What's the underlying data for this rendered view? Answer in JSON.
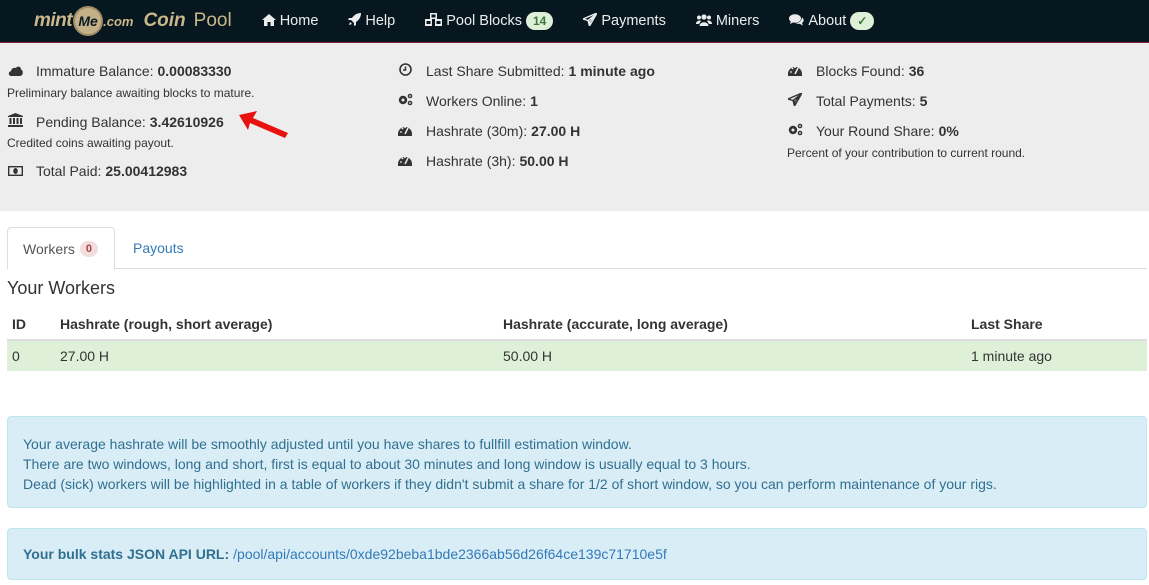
{
  "navbar": {
    "brand": {
      "mint": "mint",
      "me": "Me",
      "dotcom": ".com",
      "coin": "Coin",
      "pool": "Pool"
    },
    "items": [
      {
        "label": "Home",
        "icon": "home-icon",
        "glyph": "⌂"
      },
      {
        "label": "Help",
        "icon": "rocket-icon",
        "glyph": "🚀"
      },
      {
        "label": "Pool Blocks",
        "icon": "cubes-icon",
        "glyph": "❖",
        "badge": "14"
      },
      {
        "label": "Payments",
        "icon": "paper-plane-icon",
        "glyph": "➢"
      },
      {
        "label": "Miners",
        "icon": "users-icon",
        "glyph": "👥"
      },
      {
        "label": "About",
        "icon": "comments-icon",
        "glyph": "💬",
        "badge": "✓"
      }
    ],
    "colors": {
      "background": "#061720",
      "accent_border": "#8a1d3a",
      "brand": "#cbb78b"
    }
  },
  "stats": {
    "immature_balance": {
      "label": "Immature Balance:",
      "value": "0.00083330",
      "note": "Preliminary balance awaiting blocks to mature.",
      "icon": "cloud-icon"
    },
    "pending_balance": {
      "label": "Pending Balance:",
      "value": "3.42610926",
      "note": "Credited coins awaiting payout.",
      "icon": "bank-icon"
    },
    "total_paid": {
      "label": "Total Paid:",
      "value": "25.00412983",
      "icon": "money-icon"
    },
    "last_share": {
      "label": "Last Share Submitted:",
      "value": "1 minute ago",
      "icon": "clock-icon"
    },
    "workers_online": {
      "label": "Workers Online:",
      "value": "1",
      "icon": "gears-icon"
    },
    "hashrate_30m": {
      "label": "Hashrate (30m):",
      "value": "27.00 H",
      "icon": "dashboard-icon"
    },
    "hashrate_3h": {
      "label": "Hashrate (3h):",
      "value": "50.00 H",
      "icon": "dashboard-icon"
    },
    "blocks_found": {
      "label": "Blocks Found:",
      "value": "36",
      "icon": "dashboard-icon"
    },
    "total_payments": {
      "label": "Total Payments:",
      "value": "5",
      "icon": "paper-plane-icon"
    },
    "round_share": {
      "label": "Your Round Share:",
      "value": "0%",
      "note": "Percent of your contribution to current round.",
      "icon": "gears-icon"
    }
  },
  "tabs": [
    {
      "label": "Workers",
      "badge": "0",
      "active": true
    },
    {
      "label": "Payouts",
      "active": false
    }
  ],
  "workers": {
    "title": "Your Workers",
    "columns": [
      "ID",
      "Hashrate (rough, short average)",
      "Hashrate (accurate, long average)",
      "Last Share"
    ],
    "rows": [
      [
        "0",
        "27.00 H",
        "50.00 H",
        "1 minute ago"
      ]
    ]
  },
  "info": {
    "lines": [
      "Your average hashrate will be smoothly adjusted until you have shares to fullfill estimation window.",
      "There are two windows, long and short, first is equal to about 30 minutes and long window is usually equal to 3 hours.",
      "Dead (sick) workers will be highlighted in a table of workers if they didn't submit a share for 1/2 of short window, so you can perform maintenance of your rigs."
    ],
    "api_label": "Your bulk stats JSON API URL:",
    "api_url": "/pool/api/accounts/0xde92beba1bde2366ab56d26f64ce139c71710e5f"
  }
}
